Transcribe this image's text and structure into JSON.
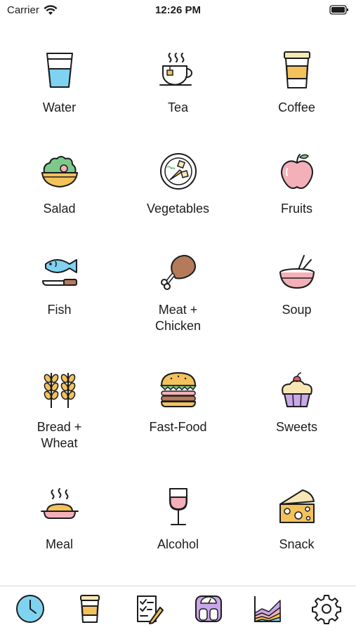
{
  "status_bar": {
    "carrier": "Carrier",
    "time": "12:26 PM"
  },
  "categories": [
    {
      "label": "Water",
      "icon": "water-glass-icon"
    },
    {
      "label": "Tea",
      "icon": "tea-cup-icon"
    },
    {
      "label": "Coffee",
      "icon": "coffee-cup-icon"
    },
    {
      "label": "Salad",
      "icon": "salad-bowl-icon"
    },
    {
      "label": "Vegetables",
      "icon": "vegetables-plate-icon"
    },
    {
      "label": "Fruits",
      "icon": "apple-icon"
    },
    {
      "label": "Fish",
      "icon": "fish-knife-icon"
    },
    {
      "label": "Meat +\nChicken",
      "icon": "chicken-leg-icon"
    },
    {
      "label": "Soup",
      "icon": "soup-bowl-icon"
    },
    {
      "label": "Bread +\nWheat",
      "icon": "wheat-icon"
    },
    {
      "label": "Fast-Food",
      "icon": "burger-icon"
    },
    {
      "label": "Sweets",
      "icon": "cupcake-icon"
    },
    {
      "label": "Meal",
      "icon": "hot-meal-icon"
    },
    {
      "label": "Alcohol",
      "icon": "wine-glass-icon"
    },
    {
      "label": "Snack",
      "icon": "cheese-icon"
    }
  ],
  "tab_bar": [
    {
      "icon": "clock-icon",
      "active": true
    },
    {
      "icon": "coffee-cup-icon",
      "active": false
    },
    {
      "icon": "checklist-icon",
      "active": false
    },
    {
      "icon": "scale-icon",
      "active": false
    },
    {
      "icon": "stacked-chart-icon",
      "active": false
    },
    {
      "icon": "gear-icon",
      "active": false
    }
  ],
  "colors": {
    "accent_blue": "#7fd3f0",
    "beige": "#f7e7b4",
    "pink": "#f3b0b8",
    "green": "#7cc98a",
    "brown": "#b57a5a",
    "orange": "#f4c25b",
    "outline": "#1c1c1e"
  }
}
